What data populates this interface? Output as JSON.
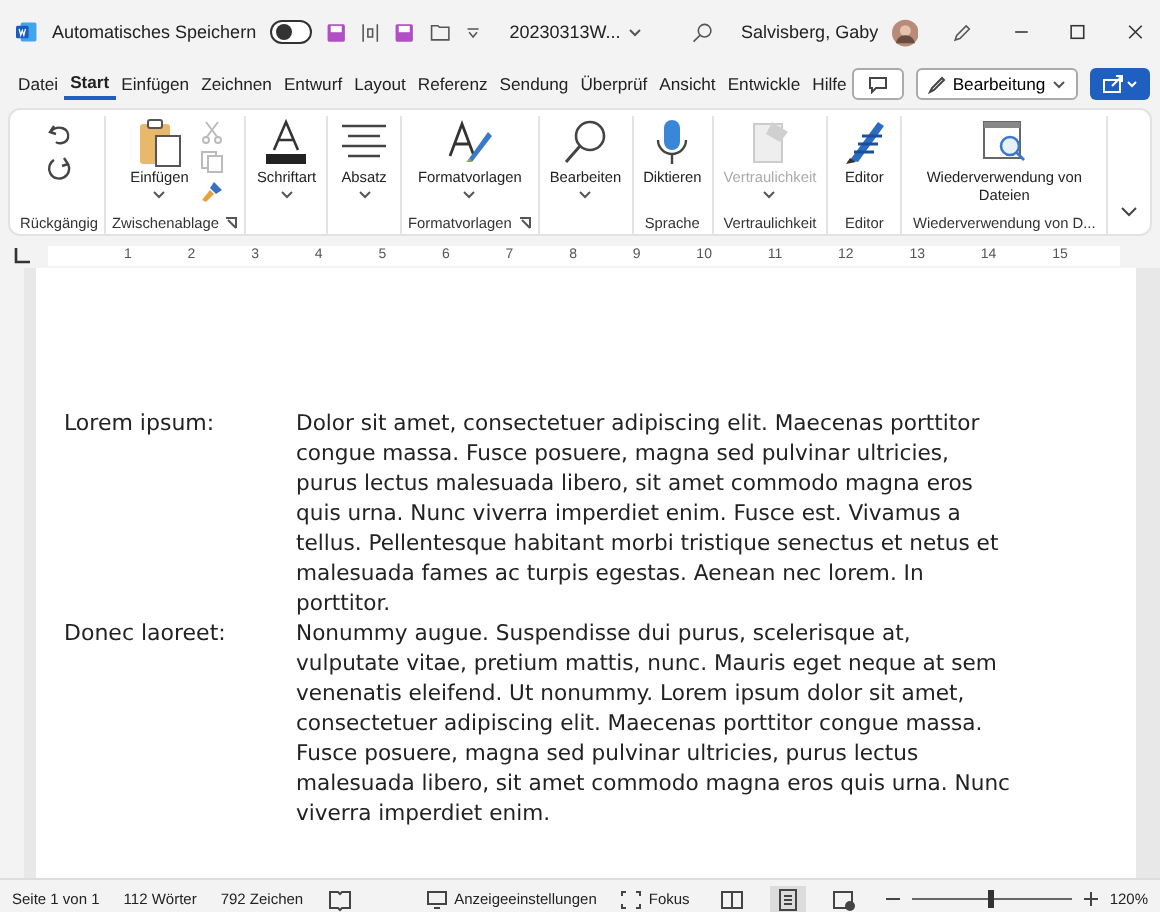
{
  "title_bar": {
    "autosave_label": "Automatisches Speichern",
    "autosave_on": false,
    "filename": "20230313W...",
    "user": "Salvisberg, Gaby"
  },
  "menu_tabs": [
    {
      "label": "Datei",
      "selected": false
    },
    {
      "label": "Start",
      "selected": true
    },
    {
      "label": "Einfügen",
      "selected": false
    },
    {
      "label": "Zeichnen",
      "selected": false
    },
    {
      "label": "Entwurf",
      "selected": false
    },
    {
      "label": "Layout",
      "selected": false
    },
    {
      "label": "Referenz",
      "selected": false
    },
    {
      "label": "Sendung",
      "selected": false
    },
    {
      "label": "Überprüf",
      "selected": false
    },
    {
      "label": "Ansicht",
      "selected": false
    },
    {
      "label": "Entwickle",
      "selected": false
    },
    {
      "label": "Hilfe",
      "selected": false
    }
  ],
  "editing_button": {
    "label": "Bearbeitung"
  },
  "ribbon_groups": [
    {
      "label": "Rückgängig",
      "launcher": false,
      "buttons": [
        {
          "kind": "undo"
        },
        {
          "kind": "redo"
        }
      ]
    },
    {
      "label": "Zwischenablage",
      "launcher": true,
      "buttons": [
        {
          "kind": "paste",
          "label": "Einfügen",
          "dropdown": true,
          "disabled": false
        },
        {
          "kind": "cut"
        },
        {
          "kind": "copy"
        },
        {
          "kind": "painter"
        }
      ]
    },
    {
      "launcher": false,
      "buttons": [
        {
          "kind": "font",
          "label": "Schriftart",
          "dropdown": true,
          "disabled": false
        }
      ]
    },
    {
      "launcher": false,
      "buttons": [
        {
          "kind": "paragraph",
          "label": "Absatz",
          "dropdown": true,
          "disabled": false
        }
      ]
    },
    {
      "label": "Formatvorlagen",
      "launcher": true,
      "buttons": [
        {
          "kind": "styles",
          "label": "Formatvorlagen",
          "dropdown": true,
          "disabled": false
        }
      ]
    },
    {
      "launcher": false,
      "buttons": [
        {
          "kind": "search",
          "label": "Bearbeiten",
          "dropdown": true,
          "disabled": false
        }
      ]
    },
    {
      "label": "Sprache",
      "launcher": false,
      "buttons": [
        {
          "kind": "mic",
          "label": "Diktieren",
          "dropdown": false,
          "disabled": false
        }
      ]
    },
    {
      "label": "Vertraulichkeit",
      "launcher": false,
      "buttons": [
        {
          "kind": "sensitivity",
          "label": "Vertraulichkeit",
          "dropdown": true,
          "disabled": true
        }
      ]
    },
    {
      "label": "Editor",
      "launcher": false,
      "buttons": [
        {
          "kind": "editor",
          "label": "Editor",
          "dropdown": false,
          "disabled": false
        }
      ]
    },
    {
      "label": "Wiederverwendung von D...",
      "launcher": false,
      "buttons": [
        {
          "kind": "reuse",
          "label": "Wiederverwendung von Dateien",
          "dropdown": false,
          "disabled": false
        }
      ]
    }
  ],
  "ruler_numbers": [
    "1",
    "2",
    "3",
    "4",
    "5",
    "6",
    "7",
    "8",
    "9",
    "10",
    "11",
    "12",
    "13",
    "14",
    "15"
  ],
  "document": [
    {
      "term": "Lorem ipsum:",
      "text": "Dolor sit amet, consectetuer adipiscing elit. Maecenas porttitor congue massa. Fusce posuere, magna sed pulvinar ultricies, purus lectus malesuada libero, sit amet commodo magna eros quis urna. Nunc viverra imperdiet enim. Fusce est. Vivamus a tellus. Pellentesque habitant morbi tristique senectus et netus et malesuada fames ac turpis egestas. Aenean nec lorem. In porttitor."
    },
    {
      "term": "Donec laoreet:",
      "text": "Nonummy augue. Suspendisse dui purus, scelerisque at, vulputate vitae, pretium mattis, nunc. Mauris eget neque at sem venenatis eleifend. Ut nonummy. Lorem ipsum dolor sit amet, consectetuer adipiscing elit. Maecenas porttitor congue massa. Fusce posuere, magna sed pulvinar ultricies, purus lectus malesuada libero, sit amet commodo magna eros quis urna. Nunc viverra imperdiet enim."
    }
  ],
  "status_bar": {
    "page": "Seite 1 von 1",
    "words": "112 Wörter",
    "chars": "792 Zeichen",
    "display_settings": "Anzeigeeinstellungen",
    "focus": "Fokus",
    "views": [
      {
        "kind": "read",
        "selected": false
      },
      {
        "kind": "print",
        "selected": true
      },
      {
        "kind": "web",
        "selected": false
      }
    ],
    "zoom": {
      "level": 0.5,
      "reading": "120%"
    }
  }
}
